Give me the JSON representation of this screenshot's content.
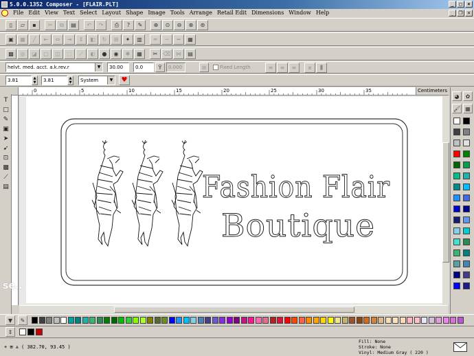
{
  "window": {
    "title": "5.0.0.1352 Composer - [FLAIR.PLT]"
  },
  "menu": {
    "items": [
      "File",
      "Edit",
      "View",
      "Text",
      "Select",
      "Layout",
      "Shape",
      "Image",
      "Tools",
      "Arrange",
      "Retail Edit",
      "Dimensions",
      "Window",
      "Help"
    ]
  },
  "text_toolbar": {
    "font": "helvt. med. acct. a.k.rev.r",
    "size": "30.00",
    "spacing": "0.0",
    "width_value": "0.000",
    "fixed_length_label": "Fixed Length"
  },
  "dims_toolbar": {
    "width": "3.81",
    "height": "3.81",
    "system": "System"
  },
  "ruler": {
    "units": "Centimeters",
    "ticks": [
      "5",
      "0",
      "5",
      "10",
      "15",
      "20",
      "25",
      "30",
      "35"
    ]
  },
  "canvas": {
    "line1": "Fashion Flair",
    "line2": "Boutique"
  },
  "status": {
    "coords": "( 382.70, 93.45 )",
    "fill": "Fill: None",
    "stroke": "Stroke: None",
    "vinyl": "Vinyl: Medium Gray ( 220 )"
  },
  "watermark": "se..",
  "colors": {
    "title_start": "#0a246a",
    "title_end": "#a6caf0",
    "chrome": "#d4d0c8",
    "palette_vertical": [
      "#ffffff",
      "#000000",
      "#404040",
      "#808080",
      "#c0c0c0",
      "#e0e0e0",
      "#ff0000",
      "#008000",
      "#006400",
      "#00a050",
      "#00c080",
      "#20b2aa",
      "#008b8b",
      "#00bfff",
      "#1e90ff",
      "#4169e1",
      "#0000cd",
      "#00008b",
      "#191970",
      "#6495ed",
      "#87ceeb",
      "#00ced1",
      "#40e0d0",
      "#2e8b57",
      "#3cb371",
      "#008080",
      "#5f9ea0",
      "#4682b4",
      "#000080",
      "#483d8b",
      "#0000ff",
      "#1c1c8c"
    ],
    "palette_horizontal": [
      "#000000",
      "#404040",
      "#808080",
      "#c0c0c0",
      "#ffffff",
      "#00a0a0",
      "#008080",
      "#20b2aa",
      "#3cb371",
      "#2e8b57",
      "#008000",
      "#006400",
      "#00c000",
      "#32cd32",
      "#7fff00",
      "#adff2f",
      "#808000",
      "#556b2f",
      "#6b8e23",
      "#0000ff",
      "#1e90ff",
      "#00bfff",
      "#87ceeb",
      "#4682b4",
      "#483d8b",
      "#6a5acd",
      "#8a2be2",
      "#9400d3",
      "#800080",
      "#c71585",
      "#ff1493",
      "#ff69b4",
      "#db7093",
      "#b22222",
      "#dc143c",
      "#ff0000",
      "#ff4500",
      "#ff6347",
      "#ff8c00",
      "#ffa500",
      "#ffd700",
      "#ffff00",
      "#f0e68c",
      "#bdb76b",
      "#a0522d",
      "#8b4513",
      "#d2691e",
      "#cd853f",
      "#deb887",
      "#f5deb3",
      "#ffe4c4",
      "#ffdab9",
      "#ffb6c1",
      "#ffc0cb",
      "#e6e6fa",
      "#d8bfd8",
      "#dda0dd",
      "#ee82ee",
      "#da70d6",
      "#ba55d3"
    ],
    "recent": [
      "#ffffff",
      "#000000",
      "#cc0000"
    ]
  }
}
